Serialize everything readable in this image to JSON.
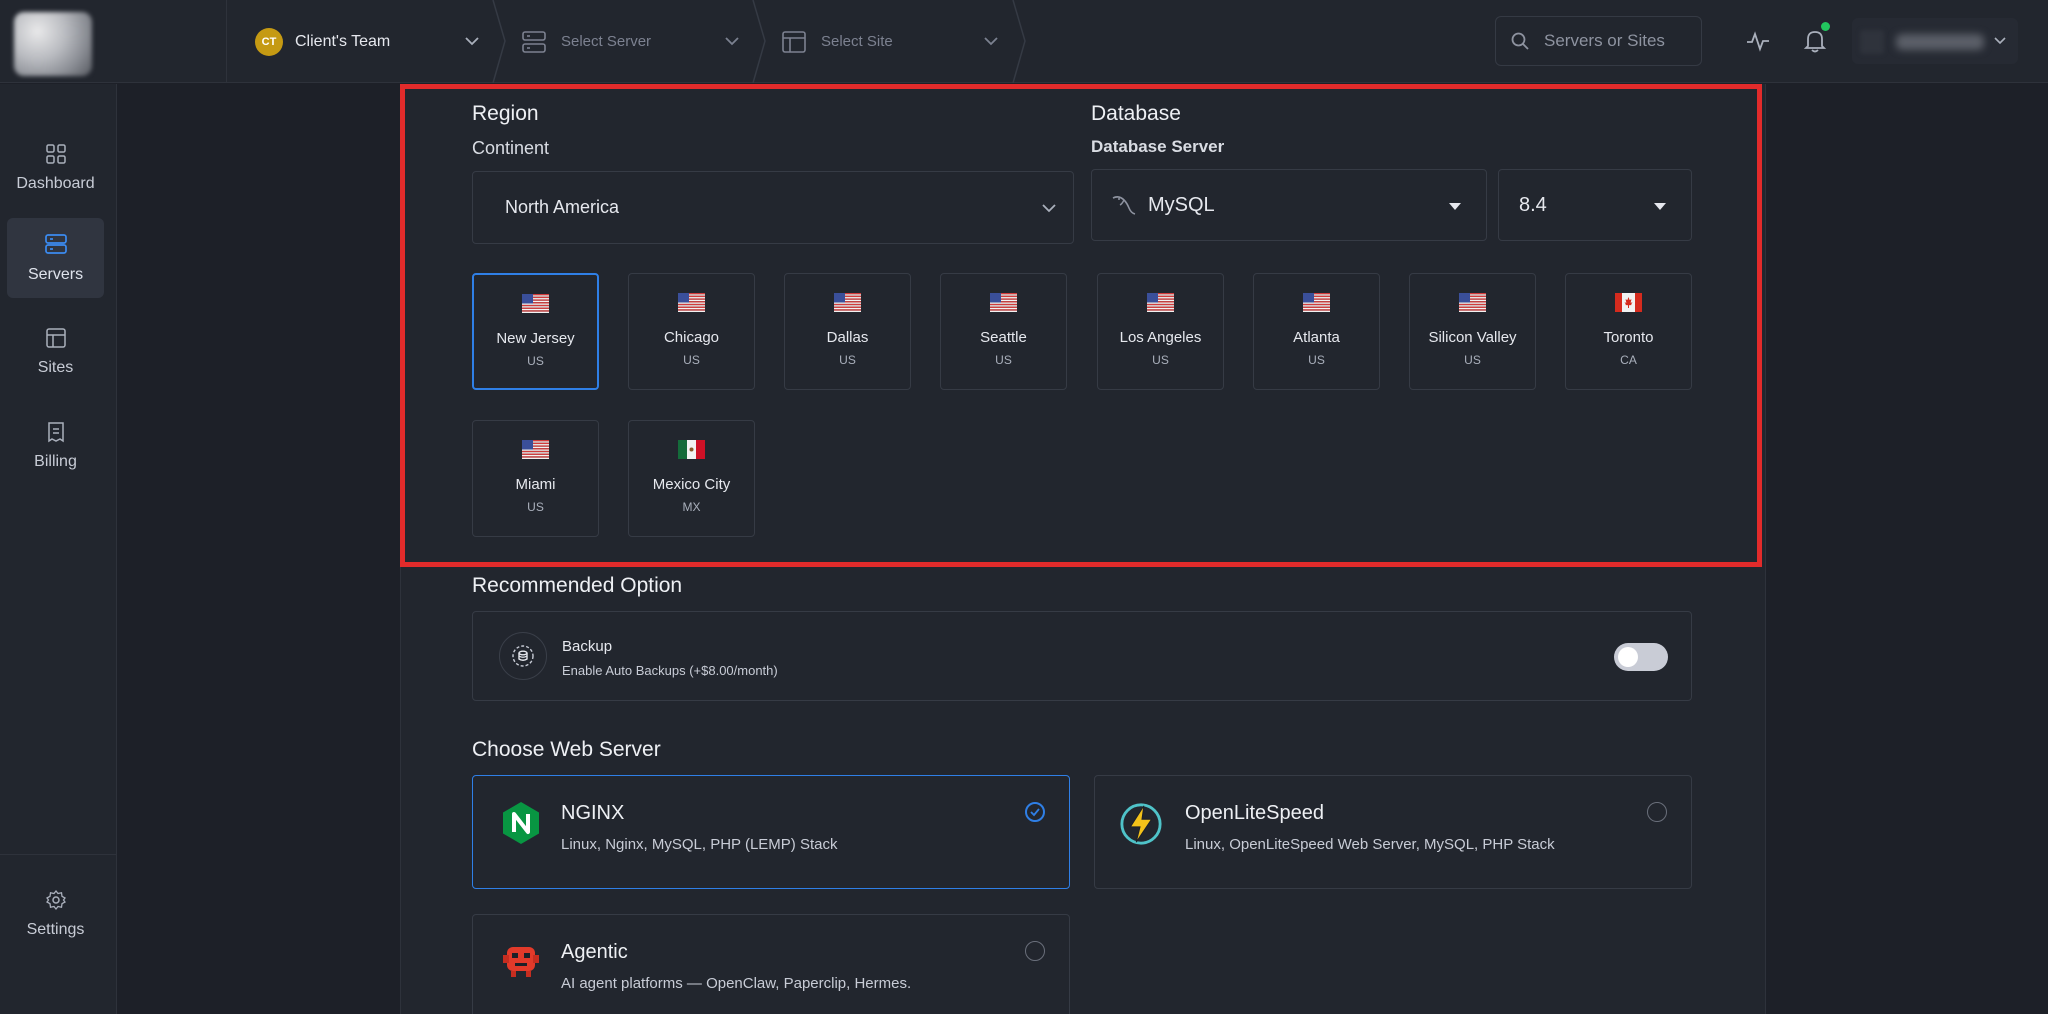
{
  "topbar": {
    "team": {
      "initials": "CT",
      "label": "Client's Team"
    },
    "server": {
      "label": "Select Server"
    },
    "site": {
      "label": "Select Site"
    },
    "search": {
      "placeholder": "Servers or Sites"
    }
  },
  "sidebar": {
    "items": [
      {
        "label": "Dashboard",
        "icon": "dashboard-icon"
      },
      {
        "label": "Servers",
        "icon": "servers-icon",
        "active": true
      },
      {
        "label": "Sites",
        "icon": "sites-icon"
      },
      {
        "label": "Billing",
        "icon": "billing-icon"
      }
    ],
    "settings": {
      "label": "Settings",
      "icon": "gear-icon"
    }
  },
  "region": {
    "title": "Region",
    "continent_label": "Continent",
    "continent_value": "North America",
    "cities": [
      {
        "city": "New Jersey",
        "code": "US",
        "flag": "us",
        "selected": true
      },
      {
        "city": "Chicago",
        "code": "US",
        "flag": "us"
      },
      {
        "city": "Dallas",
        "code": "US",
        "flag": "us"
      },
      {
        "city": "Seattle",
        "code": "US",
        "flag": "us"
      },
      {
        "city": "Los Angeles",
        "code": "US",
        "flag": "us"
      },
      {
        "city": "Atlanta",
        "code": "US",
        "flag": "us"
      },
      {
        "city": "Silicon Valley",
        "code": "US",
        "flag": "us"
      },
      {
        "city": "Toronto",
        "code": "CA",
        "flag": "ca"
      },
      {
        "city": "Miami",
        "code": "US",
        "flag": "us"
      },
      {
        "city": "Mexico City",
        "code": "MX",
        "flag": "mx"
      }
    ]
  },
  "database": {
    "title": "Database",
    "server_label": "Database Server",
    "engine": "MySQL",
    "version": "8.4"
  },
  "recommended": {
    "title": "Recommended Option",
    "backup_title": "Backup",
    "backup_desc": "Enable Auto Backups (+$8.00/month)",
    "backup_enabled": false
  },
  "webserver": {
    "title": "Choose Web Server",
    "options": [
      {
        "name": "NGINX",
        "desc": "Linux, Nginx, MySQL, PHP (LEMP) Stack",
        "selected": true
      },
      {
        "name": "OpenLiteSpeed",
        "desc": "Linux, OpenLiteSpeed Web Server, MySQL, PHP Stack",
        "selected": false
      },
      {
        "name": "Agentic",
        "desc": "AI agent platforms — OpenClaw, Paperclip, Hermes.",
        "selected": false
      }
    ]
  },
  "colors": {
    "accent": "#2f7fe6",
    "highlight": "#e22b2b",
    "background": "#1d2028",
    "panel": "#22262e"
  }
}
